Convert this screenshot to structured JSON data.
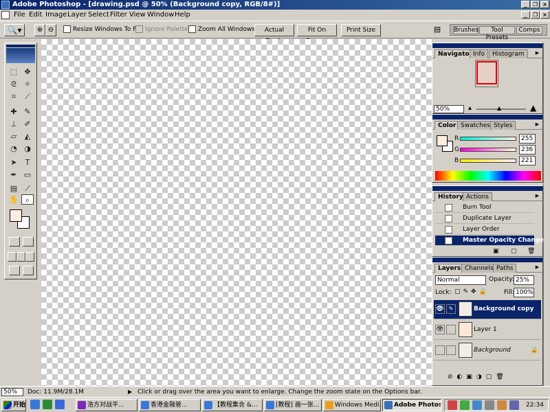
{
  "window": {
    "title": "Adobe Photoshop - [drawing.psd @ 50% (Background copy, RGB/8#)]"
  },
  "menu": [
    "File",
    "Edit",
    "Image",
    "Layer",
    "Select",
    "Filter",
    "View",
    "Window",
    "Help"
  ],
  "options": {
    "resize_windows": "Resize Windows To Fit",
    "ignore_palettes": "Ignore Palettes",
    "zoom_all_windows": "Zoom All Windows",
    "actual_pixels": "Actual Pixels",
    "fit_on_screen": "Fit On Screen",
    "print_size": "Print Size"
  },
  "palette_well": [
    "Brushes",
    "Tool Presets",
    "Comps"
  ],
  "navigator": {
    "tabs": [
      "Navigator",
      "Info",
      "Histogram"
    ],
    "zoom": "50%"
  },
  "color": {
    "tabs": [
      "Color",
      "Swatches",
      "Styles"
    ],
    "r_label": "R",
    "r": "255",
    "g_label": "G",
    "g": "236",
    "b_label": "B",
    "b": "221",
    "foreground": "#fdeee0"
  },
  "history": {
    "tabs": [
      "History",
      "Actions"
    ],
    "items": [
      "Burn Tool",
      "Duplicate Layer",
      "Layer Order",
      "Master Opacity Change"
    ]
  },
  "layers": {
    "tabs": [
      "Layers",
      "Channels",
      "Paths"
    ],
    "blend_mode": "Normal",
    "opacity_label": "Opacity:",
    "opacity": "25%",
    "lock_label": "Lock:",
    "fill_label": "Fill:",
    "fill": "100%",
    "items": [
      "Background copy",
      "Layer 1",
      "Background"
    ]
  },
  "status": {
    "zoom": "50%",
    "doc": "Doc: 11.9M/28.1M",
    "hint": "Click or drag over the area you want to enlarge. Change the zoom state on the Options bar."
  },
  "taskbar": {
    "start": "开始",
    "tasks": [
      "浩方对战平...",
      "香港金融管...",
      "【教程集合 &...",
      "[教程] 画一张...",
      "Windows Medi...",
      "Adobe Photos..."
    ],
    "clock": "22:34"
  }
}
